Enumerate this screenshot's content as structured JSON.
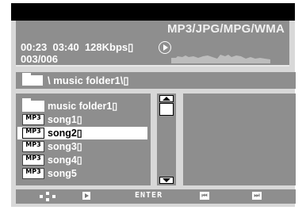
{
  "info_panel": {
    "format_label": "MP3/JPG/MPG/WMA",
    "time_line": "00:23  03:40  128Kbps▯",
    "track_count": "003/006"
  },
  "path_bar": {
    "path": "\\ music folder1\\▯"
  },
  "file_list": {
    "items": [
      {
        "type": "folder",
        "label": "music folder1▯",
        "selected": false
      },
      {
        "type": "mp3",
        "label": "song1▯",
        "selected": false
      },
      {
        "type": "mp3",
        "label": "song2▯",
        "selected": true
      },
      {
        "type": "mp3",
        "label": "song3▯",
        "selected": false
      },
      {
        "type": "mp3",
        "label": "song4▯",
        "selected": false
      },
      {
        "type": "mp3",
        "label": "song5",
        "selected": false
      }
    ],
    "mp3_icon_text": "MP3"
  },
  "controls": {
    "enter_label": "ENTER",
    "prev_icon": "skip-previous-icon",
    "next_icon": "skip-next-icon",
    "prev_glyph": "⏮",
    "next_glyph": "⏭"
  },
  "colors": {
    "panel": "#8e8e8e",
    "frame": "#d8d8d8",
    "topbar": "#000000",
    "selection": "#ffffff"
  }
}
